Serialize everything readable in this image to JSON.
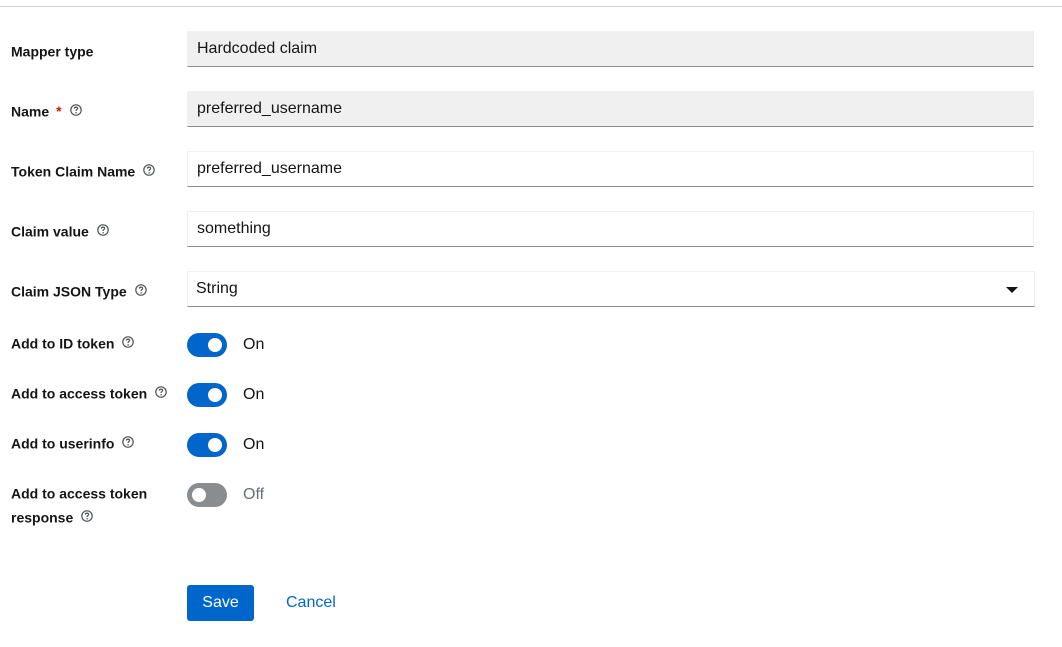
{
  "form": {
    "mapper_type": {
      "label": "Mapper type",
      "value": "Hardcoded claim"
    },
    "name": {
      "label": "Name",
      "required_mark": "*",
      "value": "preferred_username"
    },
    "token_claim_name": {
      "label": "Token Claim Name",
      "value": "preferred_username"
    },
    "claim_value": {
      "label": "Claim value",
      "value": "something"
    },
    "claim_json_type": {
      "label": "Claim JSON Type",
      "selected": "String"
    },
    "add_to_id_token": {
      "label": "Add to ID token",
      "state_label": "On",
      "on": true
    },
    "add_to_access_token": {
      "label": "Add to access token",
      "state_label": "On",
      "on": true
    },
    "add_to_userinfo": {
      "label": "Add to userinfo",
      "state_label": "On",
      "on": true
    },
    "add_to_access_token_response": {
      "label_line1": "Add to access token",
      "label_line2": "response",
      "state_label": "Off",
      "on": false
    }
  },
  "actions": {
    "save_label": "Save",
    "cancel_label": "Cancel"
  },
  "icons": {
    "help": "help-circle-icon",
    "dropdown": "caret-down-icon"
  },
  "colors": {
    "primary": "#0066cc",
    "required": "#c9190b",
    "switch_off": "#8a8d90",
    "readonly_bg": "#f0f0f0"
  }
}
